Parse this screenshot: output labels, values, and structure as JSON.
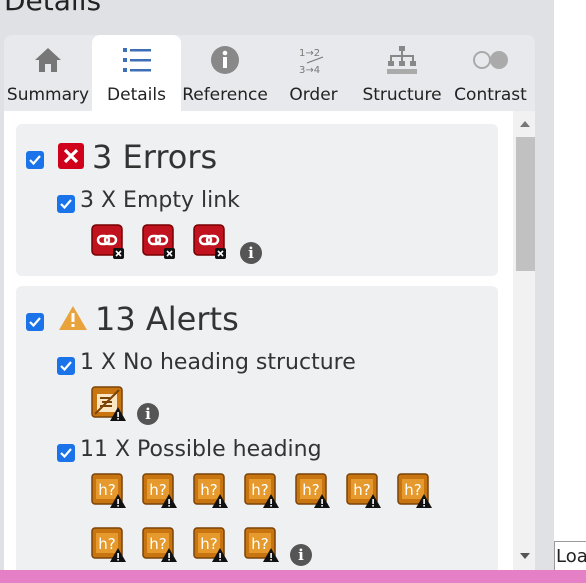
{
  "panel": {
    "title": "Details"
  },
  "tabs": [
    {
      "label": "Summary",
      "icon": "home-icon"
    },
    {
      "label": "Details",
      "icon": "list-icon"
    },
    {
      "label": "Reference",
      "icon": "info-icon"
    },
    {
      "label": "Order",
      "icon": "order-icon"
    },
    {
      "label": "Structure",
      "icon": "structure-icon"
    },
    {
      "label": "Contrast",
      "icon": "contrast-icon"
    }
  ],
  "active_tab": "Details",
  "errors": {
    "title": "3 Errors",
    "items": [
      {
        "label": "3 X Empty link",
        "count": 3,
        "icon": "empty-link-icon"
      }
    ]
  },
  "alerts": {
    "title": "13 Alerts",
    "items": [
      {
        "label": "1 X No heading structure",
        "count": 1,
        "icon": "no-heading-structure-icon"
      },
      {
        "label": "11 X Possible heading",
        "count": 11,
        "icon": "possible-heading-icon"
      }
    ]
  },
  "status_fragment": "Loa",
  "colors": {
    "accent": "#1a73e8",
    "error": "#d0021b",
    "alert": "#e8a33c",
    "panel_bg": "#dfe1e5",
    "status_bar": "#e680c6"
  }
}
